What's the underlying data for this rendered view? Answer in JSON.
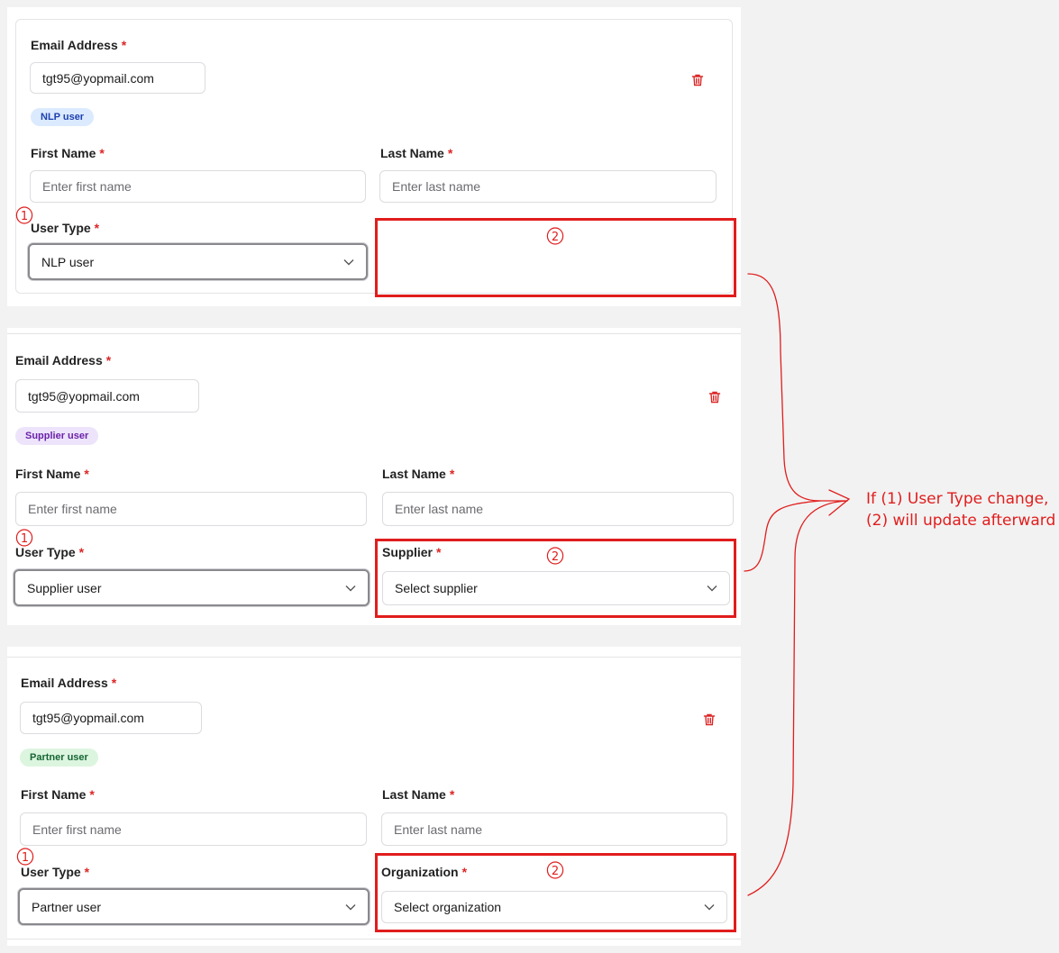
{
  "labels": {
    "email": "Email Address",
    "first_name": "First Name",
    "last_name": "Last Name",
    "user_type": "User Type",
    "supplier": "Supplier",
    "organization": "Organization",
    "required_mark": "*"
  },
  "placeholders": {
    "first_name": "Enter first name",
    "last_name": "Enter last name",
    "supplier": "Select supplier",
    "organization": "Select organization"
  },
  "forms": [
    {
      "email": "tgt95@yopmail.com",
      "badge": "NLP user",
      "user_type": "NLP user"
    },
    {
      "email": "tgt95@yopmail.com",
      "badge": "Supplier user",
      "user_type": "Supplier user"
    },
    {
      "email": "tgt95@yopmail.com",
      "badge": "Partner user",
      "user_type": "Partner user"
    }
  ],
  "annotation": {
    "marker_1": "1",
    "marker_2": "2",
    "note_line1": "If (1) User Type change,",
    "note_line2": "(2) will update afterward"
  },
  "colors": {
    "annotation_red": "#e11d1d",
    "required_red": "#dc2626",
    "badge_nlp_bg": "#dbeafe",
    "badge_nlp_fg": "#1e40af",
    "badge_supplier_bg": "#ede4fb",
    "badge_supplier_fg": "#6b21a8",
    "badge_partner_bg": "#dcf5df",
    "badge_partner_fg": "#166534"
  },
  "icons": [
    "trash-icon",
    "chevron-down-icon"
  ]
}
